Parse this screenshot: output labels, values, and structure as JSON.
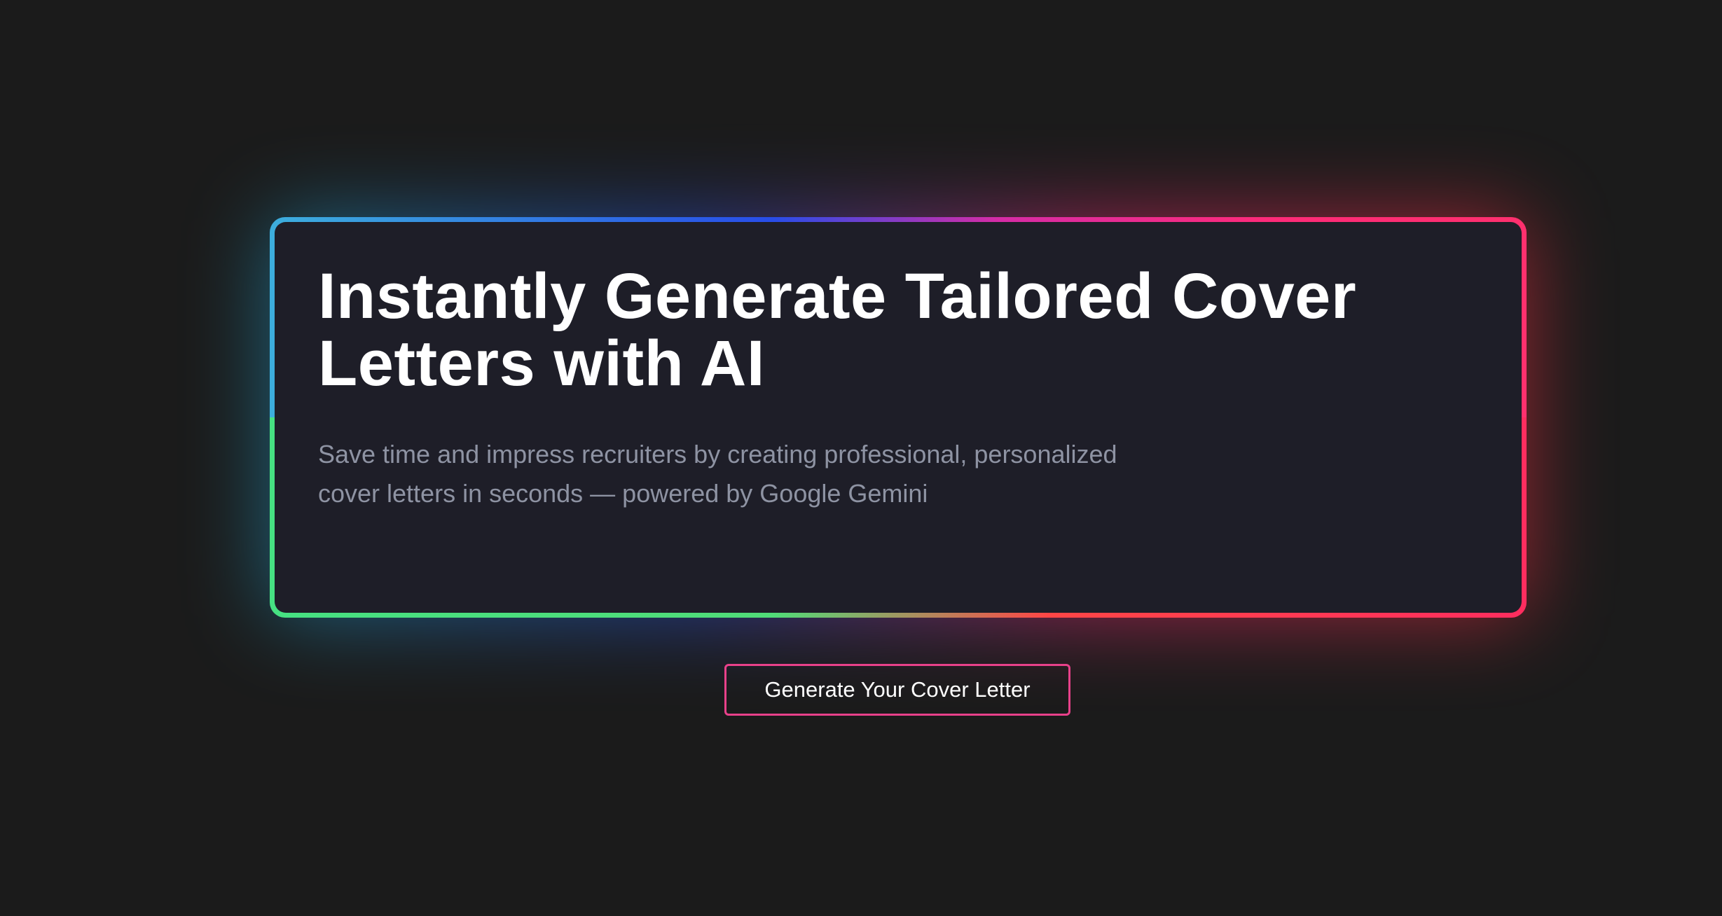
{
  "hero": {
    "headline": "Instantly Generate Tailored Cover Letters with AI",
    "subtitle": "Save time and impress recruiters by creating professional, personalized cover letters in seconds — powered by Google Gemini"
  },
  "cta": {
    "label": "Generate Your Cover Letter"
  },
  "colors": {
    "background": "#1b1b1b",
    "card": "#1e1e28",
    "cta_border": "#e8418a",
    "subtitle_text": "#8e93a3"
  }
}
